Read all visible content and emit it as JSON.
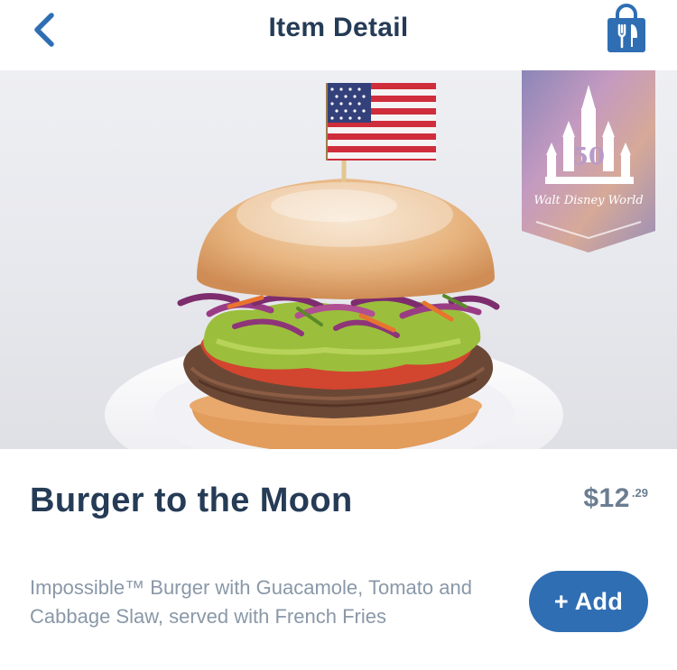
{
  "header": {
    "title": "Item Detail",
    "back_icon": "chevron-left-icon",
    "bag_icon": "shopping-bag-fork-knife-icon"
  },
  "hero": {
    "badge_brand_text": "Walt Disney World",
    "badge_number": "50"
  },
  "item": {
    "name": "Burger to the Moon",
    "price_dollars": "$12",
    "price_cents": ".29",
    "description": "Impossible™ Burger with Guacamole, Tomato and Cabbage Slaw, served with French Fries"
  },
  "actions": {
    "add_label": "+ Add"
  },
  "colors": {
    "navy_text": "#253b56",
    "accent_blue": "#2f6eb3",
    "price_gray": "#6b7d91",
    "description_gray": "#8a98a8"
  }
}
